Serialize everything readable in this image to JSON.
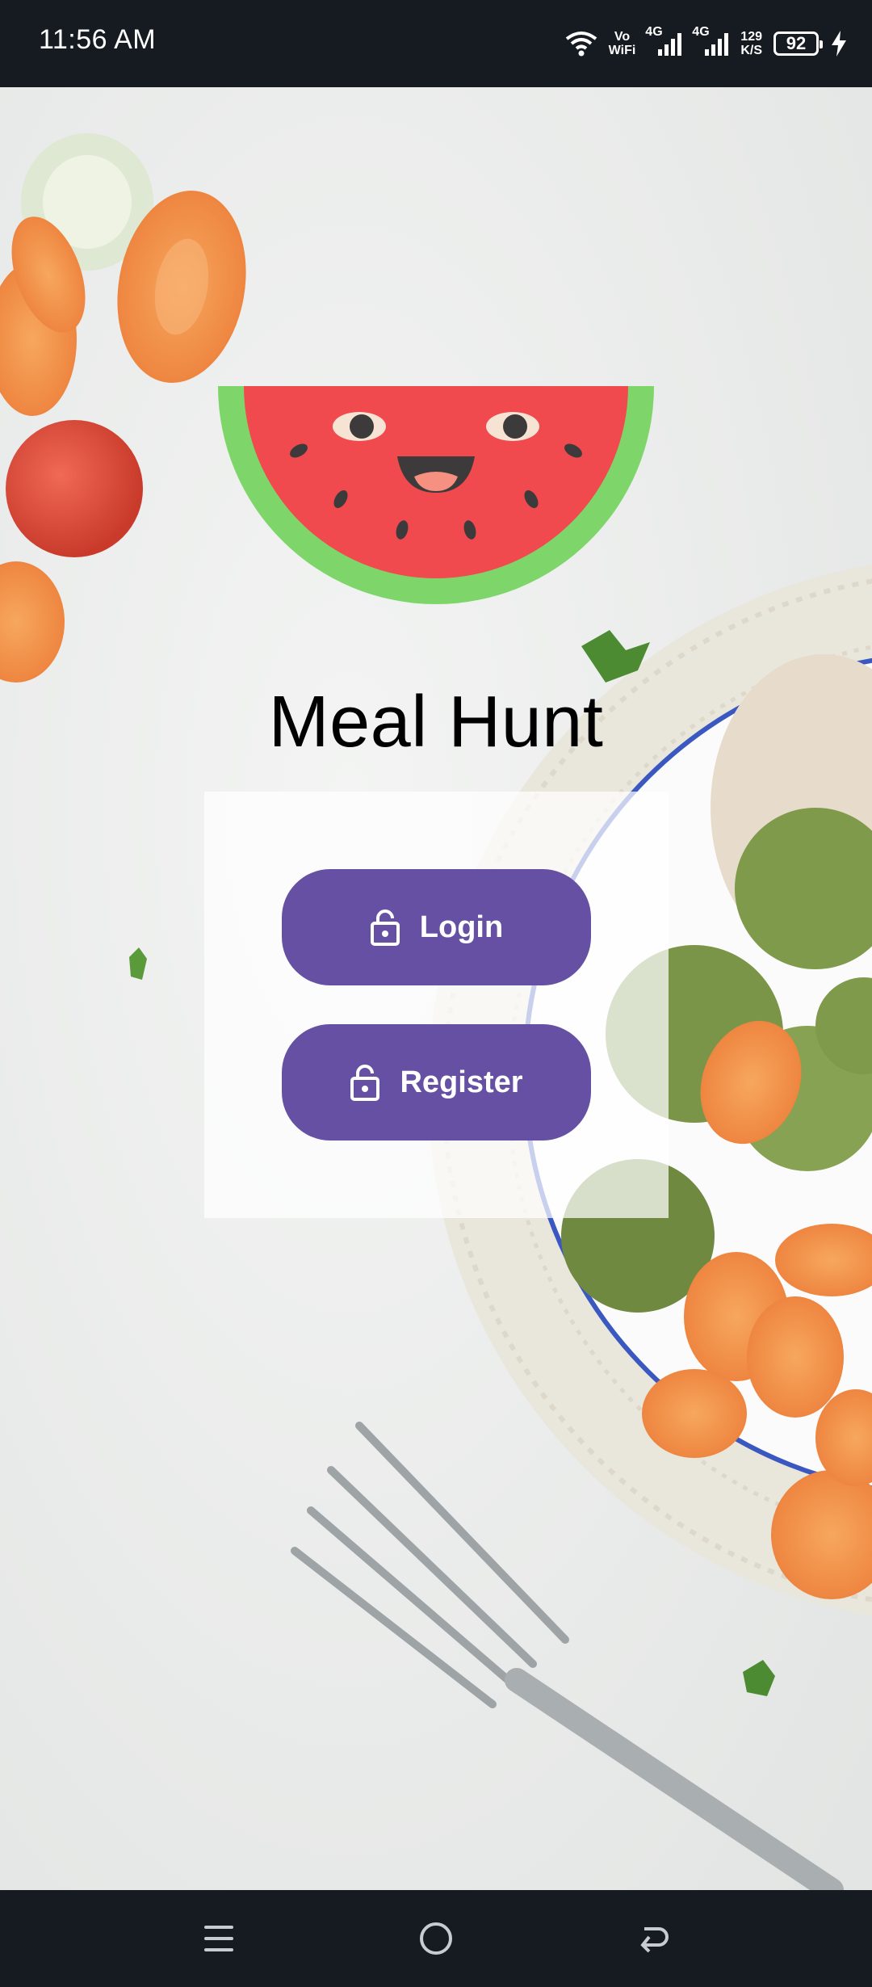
{
  "status_bar": {
    "time": "11:56 AM",
    "volte_top": "Vo",
    "volte_bottom": "WiFi",
    "network_1": "4G",
    "network_2": "4G",
    "speed_top": "129",
    "speed_bottom": "K/S",
    "battery_level": "92",
    "icons": [
      "wifi-icon",
      "signal-icon",
      "signal-icon",
      "charging-icon"
    ]
  },
  "app": {
    "title": "Meal Hunt",
    "logo": "watermelon-logo"
  },
  "buttons": {
    "login_label": "Login",
    "register_label": "Register",
    "icon": "lock-icon"
  },
  "nav_bar": {
    "icons": [
      "menu-icon",
      "home-icon",
      "back-icon"
    ]
  },
  "colors": {
    "primary": "#6650a4",
    "system_bar": "#161b22",
    "watermelon_red": "#f04a4e",
    "watermelon_rind": "#7ed66a"
  }
}
